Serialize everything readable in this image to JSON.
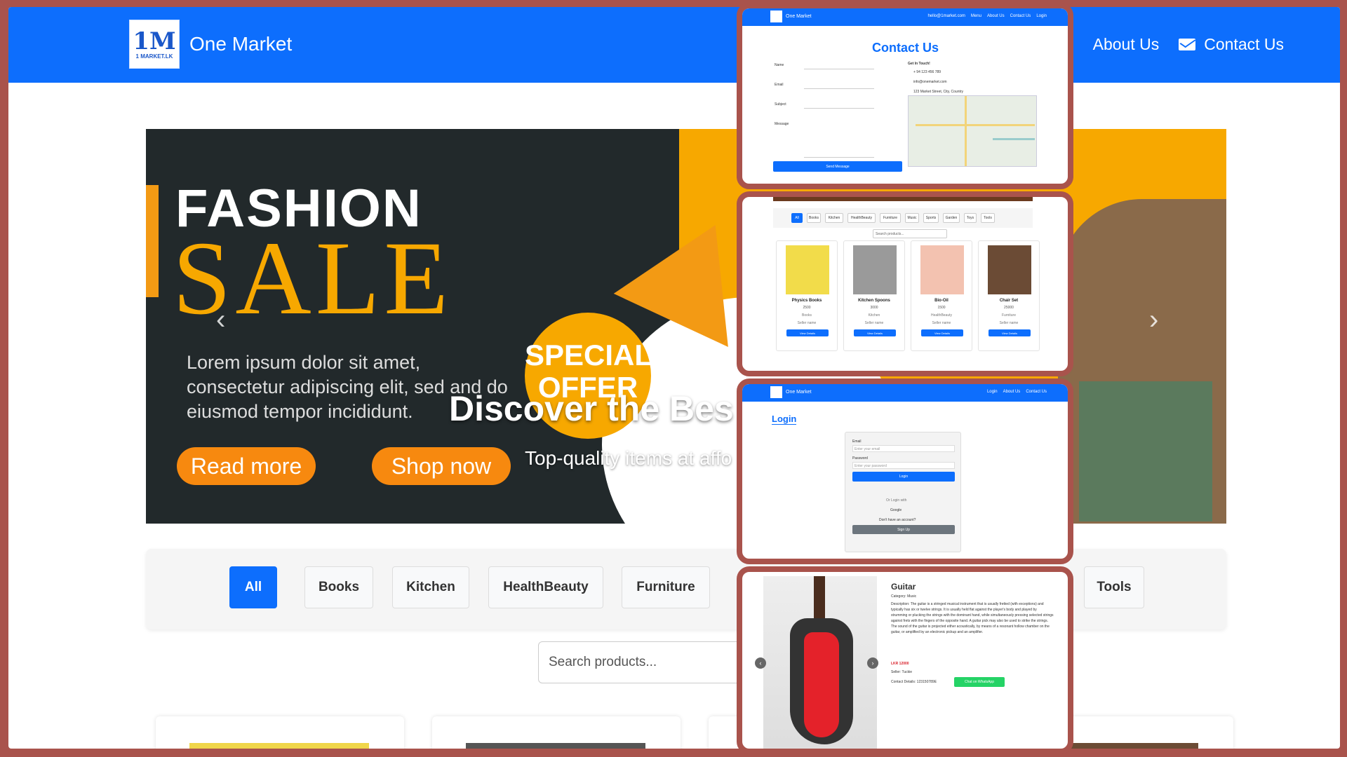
{
  "main": {
    "brand": {
      "name": "One Market",
      "logo_text": "1M",
      "logo_sub": "1 MARKET.LK"
    },
    "nav": {
      "about": "About Us",
      "contact": "Contact Us"
    },
    "hero": {
      "fashion": "FASHION",
      "sale": "SALE",
      "lorem": "Lorem ipsum dolor sit amet, consectetur adipiscing elit, sed and do eiusmod tempor incididunt.",
      "read_more": "Read more",
      "shop_now": "Shop now",
      "special": "SPECIAL OFFER",
      "discover": "Discover the Bes",
      "top_quality": "Top-quality items at affo"
    },
    "categories": [
      "All",
      "Books",
      "Kitchen",
      "HealthBeauty",
      "Furniture",
      "Tools"
    ],
    "search_placeholder": "Search products..."
  },
  "contact_panel": {
    "brand": "One Market",
    "nav": [
      "hello@1market.com",
      "Menu",
      "About Us",
      "Contact Us",
      "Login"
    ],
    "title": "Contact Us",
    "labels": [
      "Name",
      "Email",
      "Subject",
      "Message"
    ],
    "send": "Send Message",
    "get_in_touch": "Get In Touch!",
    "phone": "+ 94 123 456 789",
    "email": "info@onemarket.com",
    "address": "123 Market Street, City, Country"
  },
  "products_panel": {
    "chips": [
      "All",
      "Books",
      "Kitchen",
      "HealthBeauty",
      "Furniture",
      "Music",
      "Sports",
      "Garden",
      "Toys",
      "Tools"
    ],
    "search_placeholder": "Search products...",
    "cards": [
      {
        "name": "Physics Books",
        "price": "2500",
        "category": "Books",
        "seller": "Seller name",
        "btn": "View Details"
      },
      {
        "name": "Kitchen Spoons",
        "price": "3000",
        "category": "Kitchen",
        "seller": "Seller name",
        "btn": "View Details"
      },
      {
        "name": "Bio-Oil",
        "price": "1500",
        "category": "HealthBeauty",
        "seller": "Seller name",
        "btn": "View Details"
      },
      {
        "name": "Chair Set",
        "price": "25000",
        "category": "Furniture",
        "seller": "Seller name",
        "btn": "View Details"
      }
    ]
  },
  "login_panel": {
    "brand": "One Market",
    "nav": [
      "Login",
      "About Us",
      "Contact Us"
    ],
    "title": "Login",
    "email_label": "Email",
    "email_placeholder": "Enter your email",
    "password_label": "Password",
    "password_placeholder": "Enter your password",
    "login": "Login",
    "or_login_with": "Or Login with",
    "google": "Google",
    "no_account": "Don't have an account?",
    "signup": "Sign Up"
  },
  "product_detail": {
    "name": "Guitar",
    "category": "Category: Music",
    "description": "Description: The guitar is a stringed musical instrument that is usually fretted (with exceptions) and typically has six or twelve strings. It is usually held flat against the player's body and played by strumming or plucking the strings with the dominant hand, while simultaneously pressing selected strings against frets with the fingers of the opposite hand. A guitar pick may also be used to strike the strings. The sound of the guitar is projected either acoustically, by means of a resonant hollow chamber on the guitar, or amplified by an electronic pickup and an amplifier.",
    "price": "LKR 12000",
    "seller": "Seller: Tuckie",
    "contact": "Contact Details: 123150789E",
    "whatsapp": "Chat on WhatsApp"
  }
}
